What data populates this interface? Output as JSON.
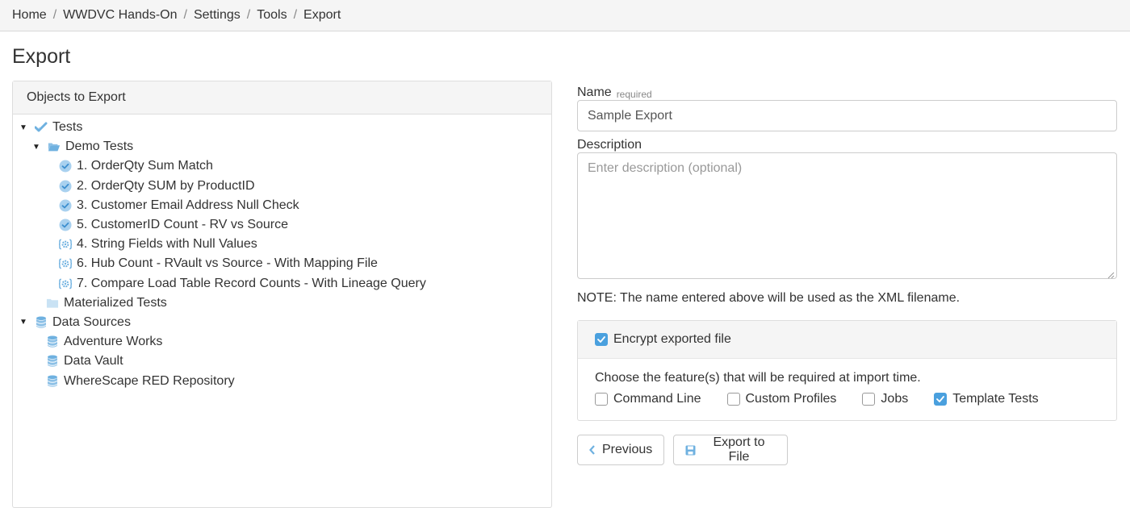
{
  "breadcrumb": {
    "items": [
      "Home",
      "WWDVC Hands-On",
      "Settings",
      "Tools",
      "Export"
    ],
    "separator": "/"
  },
  "page": {
    "title": "Export"
  },
  "objects_panel": {
    "heading": "Objects to Export",
    "tree": {
      "tests": {
        "label": "Tests",
        "demo_tests": {
          "label": "Demo Tests",
          "items": [
            {
              "label": "1. OrderQty Sum Match",
              "icon": "check-circle-icon"
            },
            {
              "label": "2. OrderQty SUM by ProductID",
              "icon": "check-circle-icon"
            },
            {
              "label": "3. Customer Email Address Null Check",
              "icon": "check-circle-icon"
            },
            {
              "label": "5. CustomerID Count - RV vs Source",
              "icon": "check-circle-icon"
            },
            {
              "label": "4. String Fields with Null Values",
              "icon": "template-gear-icon"
            },
            {
              "label": "6. Hub Count - RVault vs Source - With Mapping File",
              "icon": "template-gear-icon"
            },
            {
              "label": "7. Compare Load Table Record Counts - With Lineage Query",
              "icon": "template-gear-icon"
            }
          ]
        },
        "materialized_tests": {
          "label": "Materialized Tests"
        }
      },
      "data_sources": {
        "label": "Data Sources",
        "items": [
          "Adventure Works",
          "Data Vault",
          "WhereScape RED Repository"
        ]
      }
    }
  },
  "form": {
    "name_label": "Name",
    "name_required": "required",
    "name_value": "Sample Export",
    "description_label": "Description",
    "description_placeholder": "Enter description (optional)",
    "note": "NOTE: The name entered above will be used as the XML filename."
  },
  "encrypt": {
    "label": "Encrypt exported file",
    "checked": true,
    "features_prompt": "Choose the feature(s) that will be required at import time.",
    "features": [
      {
        "label": "Command Line",
        "checked": false
      },
      {
        "label": "Custom Profiles",
        "checked": false
      },
      {
        "label": "Jobs",
        "checked": false
      },
      {
        "label": "Template Tests",
        "checked": true
      }
    ]
  },
  "buttons": {
    "previous": "Previous",
    "export": "Export to File"
  },
  "colors": {
    "accent": "#4aa0de",
    "icon_blue": "#6fb1e0",
    "panel_bg": "#f5f5f5",
    "border": "#dddddd"
  }
}
